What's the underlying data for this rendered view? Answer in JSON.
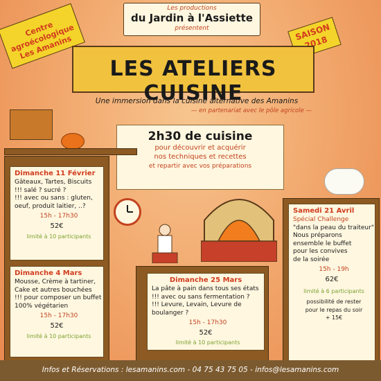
{
  "header": {
    "small_top": "Les productions",
    "big": "du Jardin à l'Assiette",
    "small_bottom": "présentent"
  },
  "tag": {
    "line1": "Centre agroécologique",
    "line2": "Les Amanins"
  },
  "saison": {
    "line1": "SAISON",
    "line2": "2018"
  },
  "title": "LES ATELIERS CUISINE",
  "subtitle": "Une immersion dans la cuisine alternative des Amanins",
  "partner": "— en partenariat avec le pôle agricole —",
  "intro": {
    "heading": "2h30 de cuisine",
    "line1": "pour découvrir et acquérir",
    "line2": "nos techniques et recettes",
    "line3": "et repartir avec vos préparations"
  },
  "cards": [
    {
      "date": "Dimanche 11 Février",
      "lines": [
        "Gâteaux, Tartes, Biscuits",
        "!!! salé ? sucré ?",
        "!!! avec ou sans : gluten,",
        "oeuf, produit laitier, ..?"
      ],
      "time": "15h - 17h30",
      "price": "52€",
      "limit": "limité à 10 participants"
    },
    {
      "date": "Dimanche 4 Mars",
      "lines": [
        "Mousse, Crème à tartiner,",
        "Cake et autres bouchées",
        "!!! pour composer un buffet",
        "100% végétarien"
      ],
      "time": "15h - 17h30",
      "price": "52€",
      "limit": "limité à 10 participants"
    },
    {
      "date": "Dimanche 25 Mars",
      "lines": [
        "La pâte à pain dans tous ses états",
        "!!! avec ou sans fermentation ?",
        "!!! Levure, Levain, Levure de boulanger ?"
      ],
      "time": "15h - 17h30",
      "price": "52€",
      "limit": "limité à 10 participants"
    },
    {
      "date": "Samedi 21 Avril",
      "special": "Spécial Challenge",
      "lines": [
        "\"dans la peau du traiteur\"",
        "Nous préparons",
        "ensemble le buffet",
        "pour les convives",
        "de la soirée"
      ],
      "time": "15h - 19h",
      "price": "62€",
      "limit": "limité à 6 participants",
      "extra1": "possibilité de rester",
      "extra2": "pour le repas du soir",
      "extra3": "+ 15€"
    }
  ],
  "footer": "Infos et Réservations : lesamanins.com - 04 75 43 75 05 - infos@lesamanins.com",
  "colors": {
    "red": "#c2421f",
    "yellow": "#f4d42a",
    "wood": "#8c5a22"
  }
}
